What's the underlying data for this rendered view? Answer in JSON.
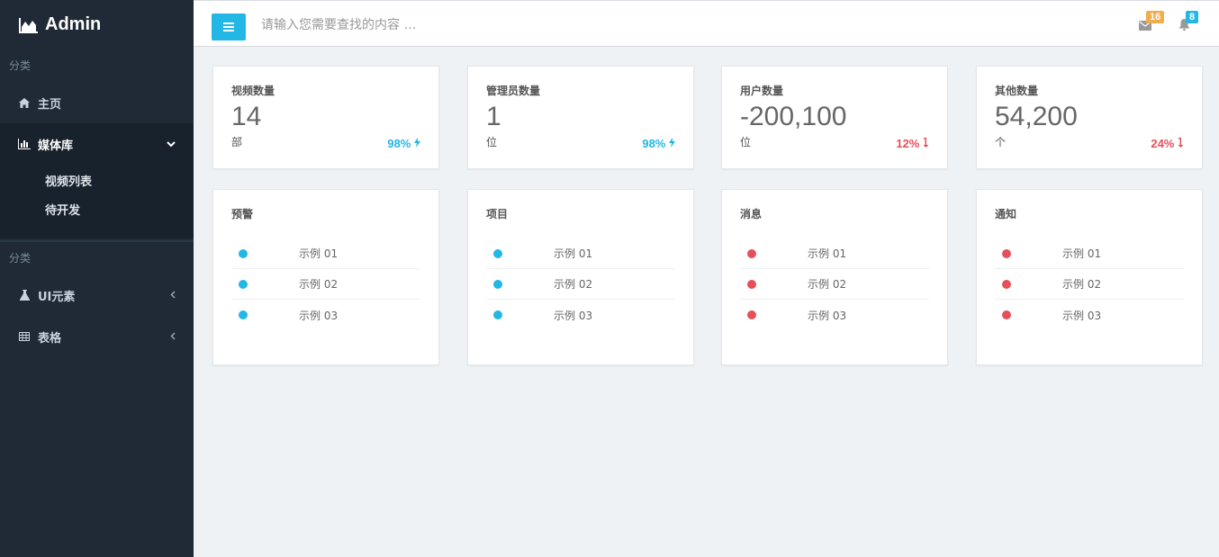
{
  "brand": {
    "title": "Admin"
  },
  "sidebar": {
    "section1": "分类",
    "home": "主页",
    "media": "媒体库",
    "media_sub": [
      "视频列表",
      "待开发"
    ],
    "section2": "分类",
    "ui": "UI元素",
    "table": "表格"
  },
  "topbar": {
    "search_placeholder": "请输入您需要查找的内容 …",
    "mail_count": "16",
    "bell_count": "8"
  },
  "stats": [
    {
      "title": "视频数量",
      "value": "14",
      "unit": "部",
      "pct": "98%",
      "trend": "up"
    },
    {
      "title": "管理员数量",
      "value": "1",
      "unit": "位",
      "pct": "98%",
      "trend": "up"
    },
    {
      "title": "用户数量",
      "value": "-200,100",
      "unit": "位",
      "pct": "12%",
      "trend": "down"
    },
    {
      "title": "其他数量",
      "value": "54,200",
      "unit": "个",
      "pct": "24%",
      "trend": "down"
    }
  ],
  "lists": [
    {
      "title": "预警",
      "items": [
        "示例 01",
        "示例 02",
        "示例 03"
      ],
      "color": "blue"
    },
    {
      "title": "项目",
      "items": [
        "示例 01",
        "示例 02",
        "示例 03"
      ],
      "color": "blue"
    },
    {
      "title": "消息",
      "items": [
        "示例 01",
        "示例 02",
        "示例 03"
      ],
      "color": "red"
    },
    {
      "title": "通知",
      "items": [
        "示例 01",
        "示例 02",
        "示例 03"
      ],
      "color": "red"
    }
  ],
  "colors": {
    "accent": "#23b7e5",
    "danger": "#e5505a",
    "warning": "#f0ad4e",
    "sidebar": "#1f2a36"
  }
}
